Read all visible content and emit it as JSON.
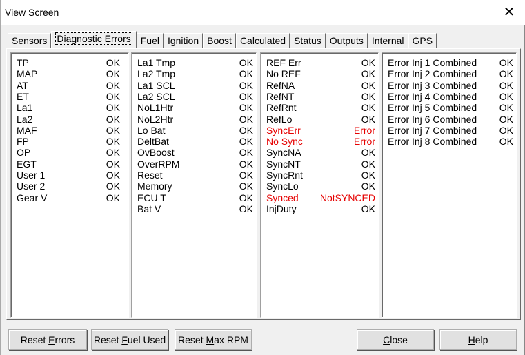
{
  "window": {
    "title": "View Screen",
    "close_label": "✕"
  },
  "tabs": [
    {
      "label": "Sensors"
    },
    {
      "label": "Diagnostic Errors"
    },
    {
      "label": "Fuel"
    },
    {
      "label": "Ignition"
    },
    {
      "label": "Boost"
    },
    {
      "label": "Calculated"
    },
    {
      "label": "Status"
    },
    {
      "label": "Outputs"
    },
    {
      "label": "Internal"
    },
    {
      "label": "GPS"
    }
  ],
  "active_tab": "Diagnostic Errors",
  "columns": [
    {
      "rows": [
        {
          "label": "TP",
          "value": "OK"
        },
        {
          "label": "MAP",
          "value": "OK"
        },
        {
          "label": "AT",
          "value": "OK"
        },
        {
          "label": "ET",
          "value": "OK"
        },
        {
          "label": "La1",
          "value": "OK"
        },
        {
          "label": "La2",
          "value": "OK"
        },
        {
          "label": "MAF",
          "value": "OK"
        },
        {
          "label": "FP",
          "value": "OK"
        },
        {
          "label": "OP",
          "value": "OK"
        },
        {
          "label": "EGT",
          "value": "OK"
        },
        {
          "label": "User 1",
          "value": "OK"
        },
        {
          "label": "User 2",
          "value": "OK"
        },
        {
          "label": "Gear V",
          "value": "OK"
        }
      ]
    },
    {
      "rows": [
        {
          "label": "La1 Tmp",
          "value": "OK"
        },
        {
          "label": "La2 Tmp",
          "value": "OK"
        },
        {
          "label": "La1 SCL",
          "value": "OK"
        },
        {
          "label": "La2 SCL",
          "value": "OK"
        },
        {
          "label": "NoL1Htr",
          "value": "OK"
        },
        {
          "label": "NoL2Htr",
          "value": "OK"
        },
        {
          "label": "Lo Bat",
          "value": "OK"
        },
        {
          "label": "DeltBat",
          "value": "OK"
        },
        {
          "label": "OvBoost",
          "value": "OK"
        },
        {
          "label": "OverRPM",
          "value": "OK"
        },
        {
          "label": "Reset",
          "value": "OK"
        },
        {
          "label": "Memory",
          "value": "OK"
        },
        {
          "label": "ECU T",
          "value": "OK"
        },
        {
          "label": "Bat V",
          "value": "OK"
        }
      ]
    },
    {
      "rows": [
        {
          "label": "REF Err",
          "value": "OK"
        },
        {
          "label": "No REF",
          "value": "OK"
        },
        {
          "label": "RefNA",
          "value": "OK"
        },
        {
          "label": "RefNT",
          "value": "OK"
        },
        {
          "label": "RefRnt",
          "value": "OK"
        },
        {
          "label": "RefLo",
          "value": "OK"
        },
        {
          "label": "SyncErr",
          "value": "Error",
          "error": true
        },
        {
          "label": "No Sync",
          "value": "Error",
          "error": true
        },
        {
          "label": "SyncNA",
          "value": "OK"
        },
        {
          "label": "SyncNT",
          "value": "OK"
        },
        {
          "label": "SyncRnt",
          "value": "OK"
        },
        {
          "label": "SyncLo",
          "value": "OK"
        },
        {
          "label": "Synced",
          "value": "NotSYNCED",
          "error": true
        },
        {
          "label": "InjDuty",
          "value": "OK"
        }
      ]
    },
    {
      "rows": [
        {
          "label": "Error Inj 1 Combined",
          "value": "OK"
        },
        {
          "label": "Error Inj 2 Combined",
          "value": "OK"
        },
        {
          "label": "Error Inj 3 Combined",
          "value": "OK"
        },
        {
          "label": "Error Inj 4 Combined",
          "value": "OK"
        },
        {
          "label": "Error Inj 5 Combined",
          "value": "OK"
        },
        {
          "label": "Error Inj 6 Combined",
          "value": "OK"
        },
        {
          "label": "Error Inj 7 Combined",
          "value": "OK"
        },
        {
          "label": "Error Inj 8 Combined",
          "value": "OK"
        }
      ]
    }
  ],
  "buttons": {
    "reset_errors": {
      "pre": "Reset ",
      "key": "E",
      "post": "rrors"
    },
    "reset_fuel": {
      "pre": "Reset ",
      "key": "F",
      "post": "uel Used"
    },
    "reset_rpm": {
      "pre": "Reset ",
      "key": "M",
      "post": "ax RPM"
    },
    "close": {
      "pre": "",
      "key": "C",
      "post": "lose"
    },
    "help": {
      "pre": "",
      "key": "H",
      "post": "elp"
    }
  },
  "colors": {
    "error_text": "#e60000",
    "window_bg": "#f0f0f0",
    "panel_bg": "#ffffff"
  }
}
